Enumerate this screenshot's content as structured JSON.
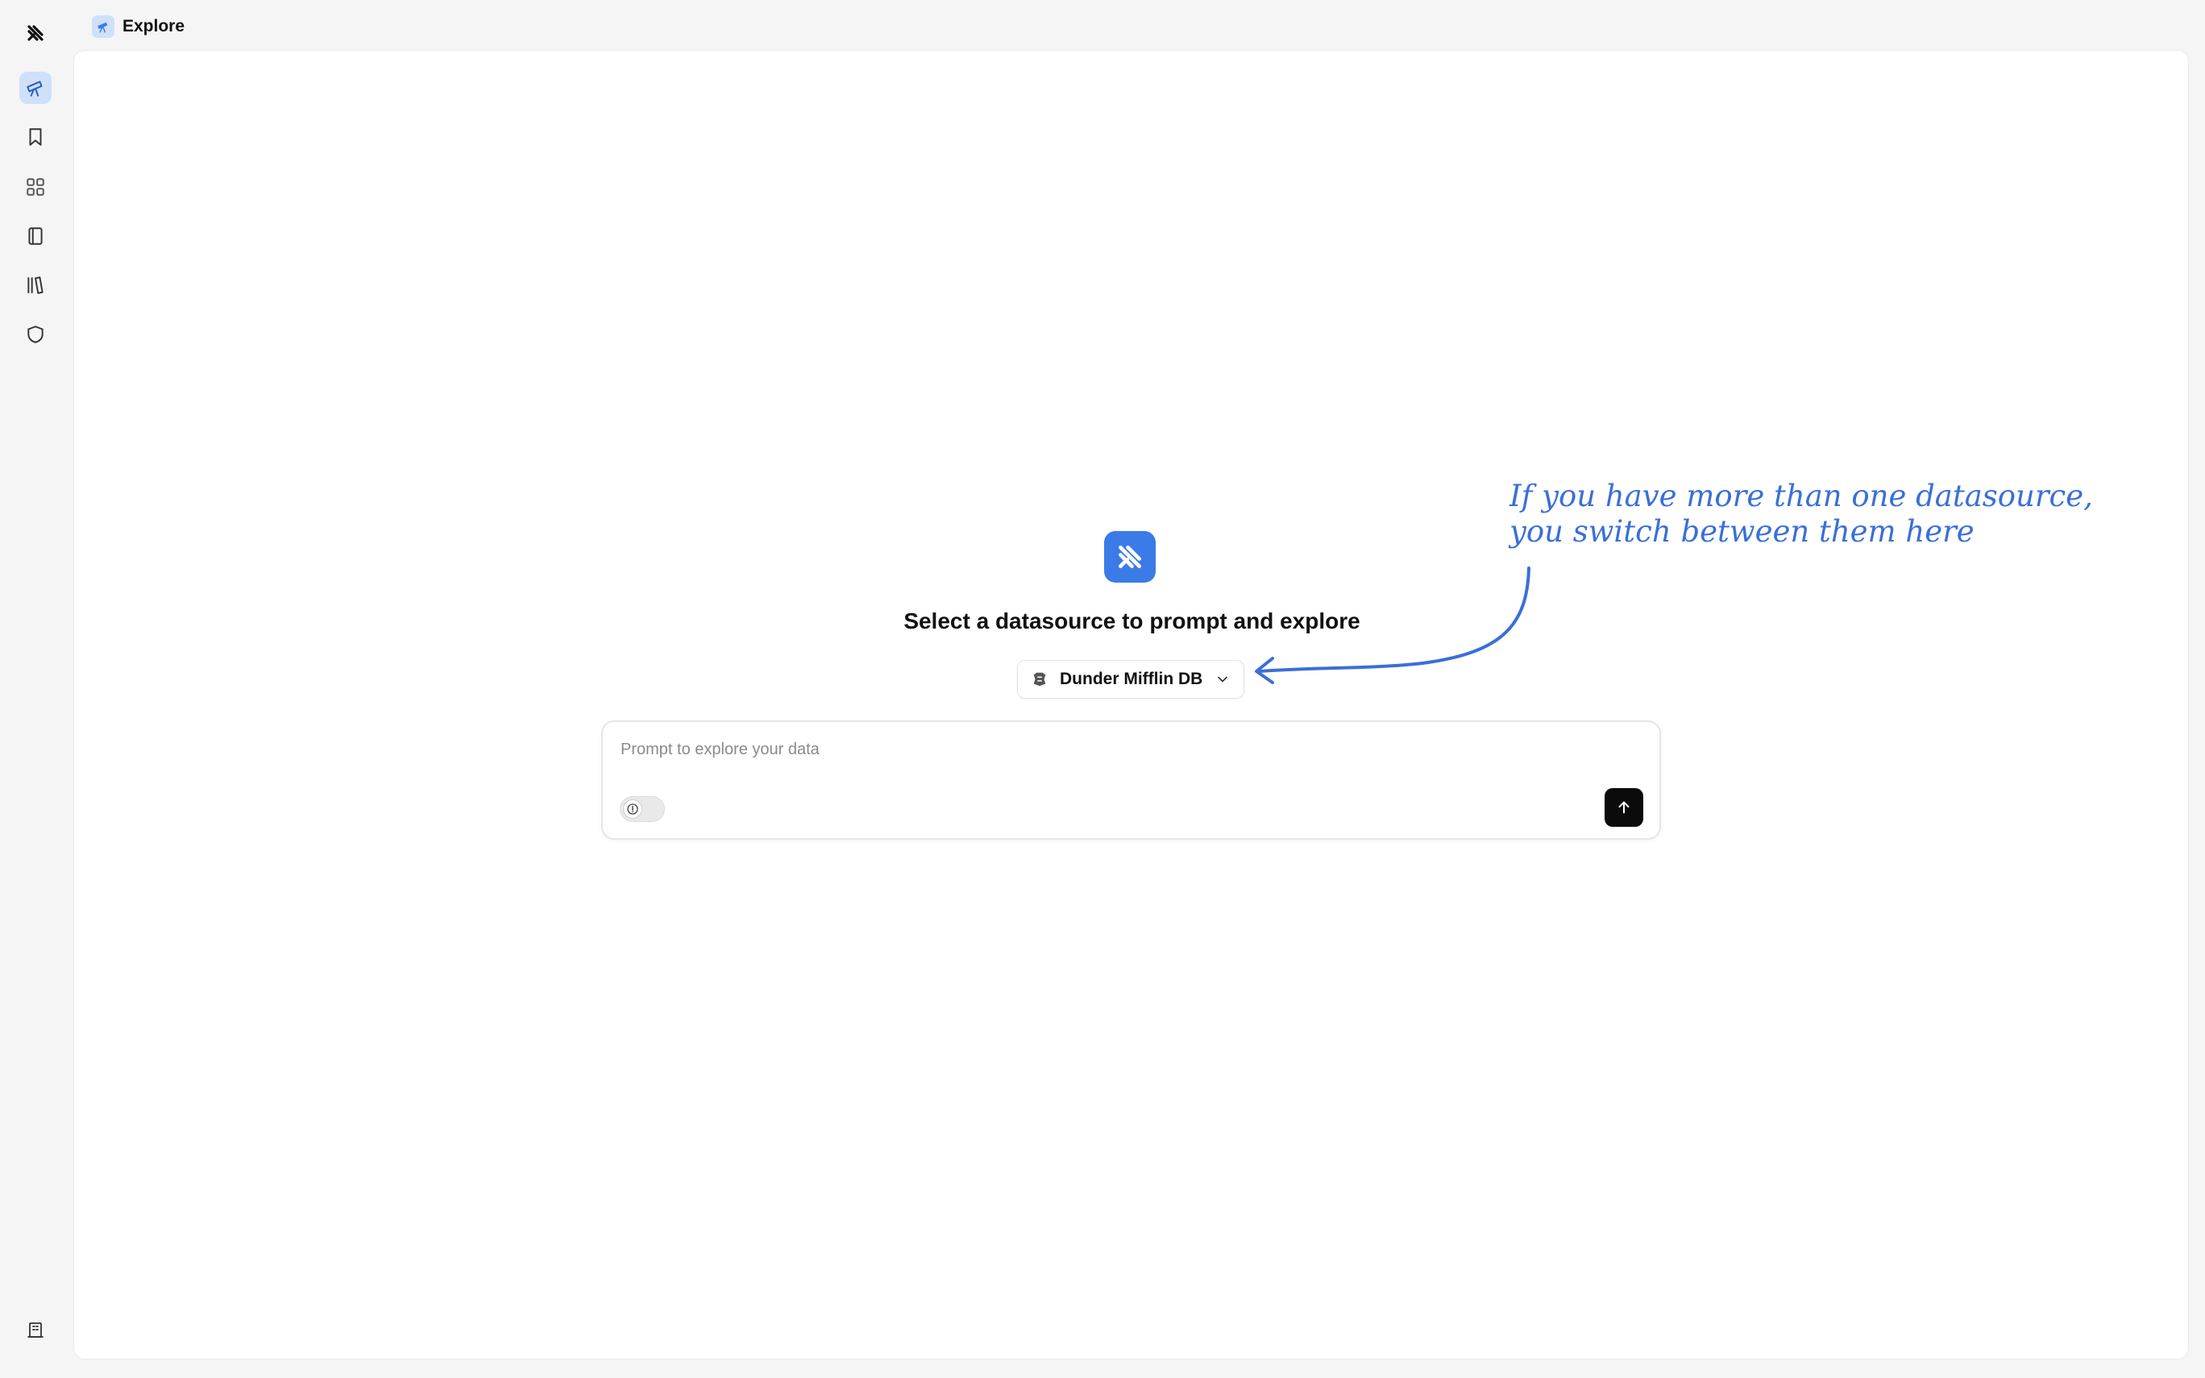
{
  "header": {
    "title": "Explore",
    "icon": "telescope-icon"
  },
  "sidebar": {
    "logo": "app-logo-icon",
    "items": [
      {
        "icon": "telescope-icon",
        "name": "explore",
        "active": true
      },
      {
        "icon": "bookmark-icon",
        "name": "saved",
        "active": false
      },
      {
        "icon": "dashboard-grid-icon",
        "name": "dashboards",
        "active": false
      },
      {
        "icon": "notebook-icon",
        "name": "notebooks",
        "active": false
      },
      {
        "icon": "library-icon",
        "name": "library",
        "active": false
      },
      {
        "icon": "shield-icon",
        "name": "security",
        "active": false
      }
    ],
    "bottom_icon": "building-icon"
  },
  "main": {
    "title": "Select a datasource to prompt and explore",
    "datasource": {
      "selected": "Dunder Mifflin DB",
      "icon": "database-icon"
    },
    "prompt": {
      "value": "",
      "placeholder": "Prompt to explore your data"
    },
    "send_icon": "arrow-up-icon"
  },
  "annotation": {
    "line1": "If you have more than one datasource,",
    "line2": "you switch between them here"
  },
  "colors": {
    "accent": "#3b7be8",
    "accent_light": "#cfe0fb",
    "annotation": "#3a6fd8",
    "background": "#f5f5f5"
  }
}
